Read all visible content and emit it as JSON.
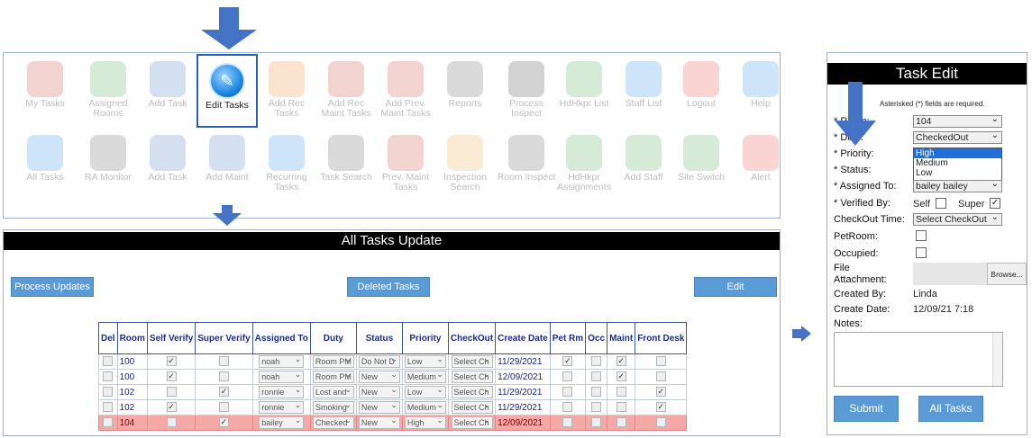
{
  "toolbar": {
    "row1": [
      {
        "label": "My Tasks",
        "icon": "my-tasks-icon",
        "color": "#c0392b"
      },
      {
        "label": "Assigned Rooms",
        "icon": "assigned-rooms-icon",
        "color": "#3fa34d"
      },
      {
        "label": "Add Task",
        "icon": "add-task-icon",
        "color": "#3b6fb6"
      },
      {
        "label": "Edit Tasks",
        "icon": "edit-tasks-icon",
        "color": "#1e88e5"
      },
      {
        "label": "Add Rec Tasks",
        "icon": "add-rec-tasks-icon",
        "color": "#e67e22"
      },
      {
        "label": "Add Rec Maint Tasks",
        "icon": "add-rec-maint-tasks-icon",
        "color": "#c0392b"
      },
      {
        "label": "Add Prev. Maint Tasks",
        "icon": "add-prev-maint-tasks-icon",
        "color": "#c0392b"
      },
      {
        "label": "Reports",
        "icon": "reports-icon",
        "color": "#555555"
      },
      {
        "label": "Process Inspect",
        "icon": "process-inspect-icon",
        "color": "#333333"
      },
      {
        "label": "HdHkpr List",
        "icon": "hdhkpr-list-icon",
        "color": "#3fa34d"
      },
      {
        "label": "Staff List",
        "icon": "staff-list-icon",
        "color": "#1e88e5"
      },
      {
        "label": "Logout",
        "icon": "logout-icon",
        "color": "#e53935"
      },
      {
        "label": "Help",
        "icon": "help-icon",
        "color": "#1e88e5"
      }
    ],
    "row2": [
      {
        "label": "All Tasks",
        "icon": "all-tasks-icon",
        "color": "#1e88e5"
      },
      {
        "label": "RA Monitor",
        "icon": "ra-monitor-icon",
        "color": "#555555"
      },
      {
        "label": "Add Task",
        "icon": "add-task-icon",
        "color": "#3b6fb6"
      },
      {
        "label": "Add Maint",
        "icon": "add-maint-icon",
        "color": "#3b6fb6"
      },
      {
        "label": "Recurring Tasks",
        "icon": "recurring-tasks-icon",
        "color": "#1e88e5"
      },
      {
        "label": "Task Search",
        "icon": "task-search-icon",
        "color": "#555555"
      },
      {
        "label": "Prev. Maint Tasks",
        "icon": "prev-maint-tasks-icon",
        "color": "#c0392b"
      },
      {
        "label": "Inspection Search",
        "icon": "inspection-search-icon",
        "color": "#e6a23c"
      },
      {
        "label": "Room Inspect",
        "icon": "room-inspect-icon",
        "color": "#555555"
      },
      {
        "label": "HdHkpr Assignments",
        "icon": "hdhkpr-assignments-icon",
        "color": "#3fa34d"
      },
      {
        "label": "Add Staff",
        "icon": "add-staff-icon",
        "color": "#3fa34d"
      },
      {
        "label": "Site Switch",
        "icon": "site-switch-icon",
        "color": "#3fa34d"
      },
      {
        "label": "Alert",
        "icon": "alert-icon",
        "color": "#e53935"
      }
    ]
  },
  "tasks_update": {
    "title": "All Tasks Update",
    "process_updates_label": "Process Updates",
    "deleted_tasks_label": "Deleted Tasks",
    "edit_label": "Edit",
    "columns": [
      "Del",
      "Room",
      "Self Verify",
      "Super Verify",
      "Assigned To",
      "Duty",
      "Status",
      "Priority",
      "CheckOut",
      "Create Date",
      "Pet Rm",
      "Occ",
      "Maint",
      "Front Desk"
    ],
    "rows": [
      {
        "room": "100",
        "self": true,
        "super": false,
        "assigned": "noah",
        "duty": "Room PM",
        "status": "Do Not D",
        "priority": "Low",
        "checkout": "Select Ch",
        "date": "11/29/2021",
        "pet": true,
        "occ": false,
        "maint": true,
        "front": false,
        "highlight": false
      },
      {
        "room": "100",
        "self": true,
        "super": false,
        "assigned": "noah",
        "duty": "Room PM",
        "status": "New",
        "priority": "Medium",
        "checkout": "Select Ch",
        "date": "12/09/2021",
        "pet": false,
        "occ": false,
        "maint": true,
        "front": false,
        "highlight": false
      },
      {
        "room": "102",
        "self": false,
        "super": true,
        "assigned": "ronnie",
        "duty": "Lost and",
        "status": "New",
        "priority": "Low",
        "checkout": "Select Ch",
        "date": "11/29/2021",
        "pet": false,
        "occ": false,
        "maint": false,
        "front": true,
        "highlight": false
      },
      {
        "room": "102",
        "self": true,
        "super": false,
        "assigned": "ronnie",
        "duty": "Smoking",
        "status": "New",
        "priority": "Medium",
        "checkout": "Select Ch",
        "date": "11/29/2021",
        "pet": false,
        "occ": false,
        "maint": false,
        "front": true,
        "highlight": false
      },
      {
        "room": "104",
        "self": false,
        "super": true,
        "assigned": "bailey",
        "duty": "Checked",
        "status": "New",
        "priority": "High",
        "checkout": "Select Ch",
        "date": "12/09/2021",
        "pet": false,
        "occ": false,
        "maint": false,
        "front": false,
        "highlight": true
      }
    ]
  },
  "task_edit": {
    "title": "Task Edit",
    "required_note": "Asterisked (*) fields are required.",
    "room_label": "* Room:",
    "room_value": "104",
    "duty_label": "* Duty:",
    "duty_value": "CheckedOut",
    "priority_label": "* Priority:",
    "priority_options": [
      "High",
      "Medium",
      "Low"
    ],
    "status_label": "* Status:",
    "assigned_label": "* Assigned To:",
    "assigned_value": "bailey bailey",
    "verified_label": "* Verified By:",
    "self_label": "Self",
    "super_label": "Super",
    "checkout_label": "CheckOut Time:",
    "checkout_value": "Select CheckOut",
    "petroom_label": "PetRoom:",
    "occupied_label": "Occupied:",
    "file_label": "File Attachment:",
    "browse_label": "Browse...",
    "created_by_label": "Created By:",
    "created_by_value": "Linda",
    "create_date_label": "Create Date:",
    "create_date_value": "12/09/21 7:18",
    "notes_label": "Notes:",
    "submit_label": "Submit",
    "all_tasks_label": "All Tasks"
  },
  "colors": {
    "accent": "#4472c4",
    "button": "#5b9bd5",
    "highlight_row": "#f4a8a8"
  }
}
